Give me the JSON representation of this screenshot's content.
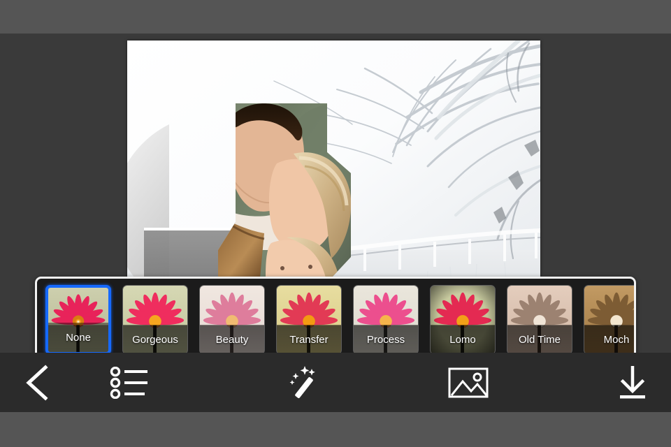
{
  "app": {
    "background_color": "#555555",
    "workspace_color": "#3a3a3a",
    "toolbar_color": "#2b2b2b",
    "accent_color": "#1569ff"
  },
  "canvas": {
    "name": "photo-canvas",
    "description": "Couple kissing collage over snowy frosted branches winter background"
  },
  "filter_bar": {
    "selected_index": 0,
    "border_color": "#f2f2f2",
    "items": [
      {
        "label": "None",
        "icon": "filter-thumbnail-none",
        "selected": true
      },
      {
        "label": "Gorgeous",
        "icon": "filter-thumbnail-gorgeous",
        "selected": false
      },
      {
        "label": "Beauty",
        "icon": "filter-thumbnail-beauty",
        "selected": false
      },
      {
        "label": "Transfer",
        "icon": "filter-thumbnail-transfer",
        "selected": false
      },
      {
        "label": "Process",
        "icon": "filter-thumbnail-process",
        "selected": false
      },
      {
        "label": "Lomo",
        "icon": "filter-thumbnail-lomo",
        "selected": false
      },
      {
        "label": "Old Time",
        "icon": "filter-thumbnail-oldtime",
        "selected": false
      },
      {
        "label": "Moch",
        "icon": "filter-thumbnail-mocha",
        "selected": false
      }
    ]
  },
  "toolbar": {
    "back_label": "Back",
    "list_label": "Frames",
    "effects_label": "Effects",
    "photo_label": "Photo",
    "save_label": "Save",
    "icons": {
      "back": "chevron-left-icon",
      "list": "list-icon",
      "effects": "magic-wand-icon",
      "photo": "image-icon",
      "save": "download-icon"
    }
  }
}
